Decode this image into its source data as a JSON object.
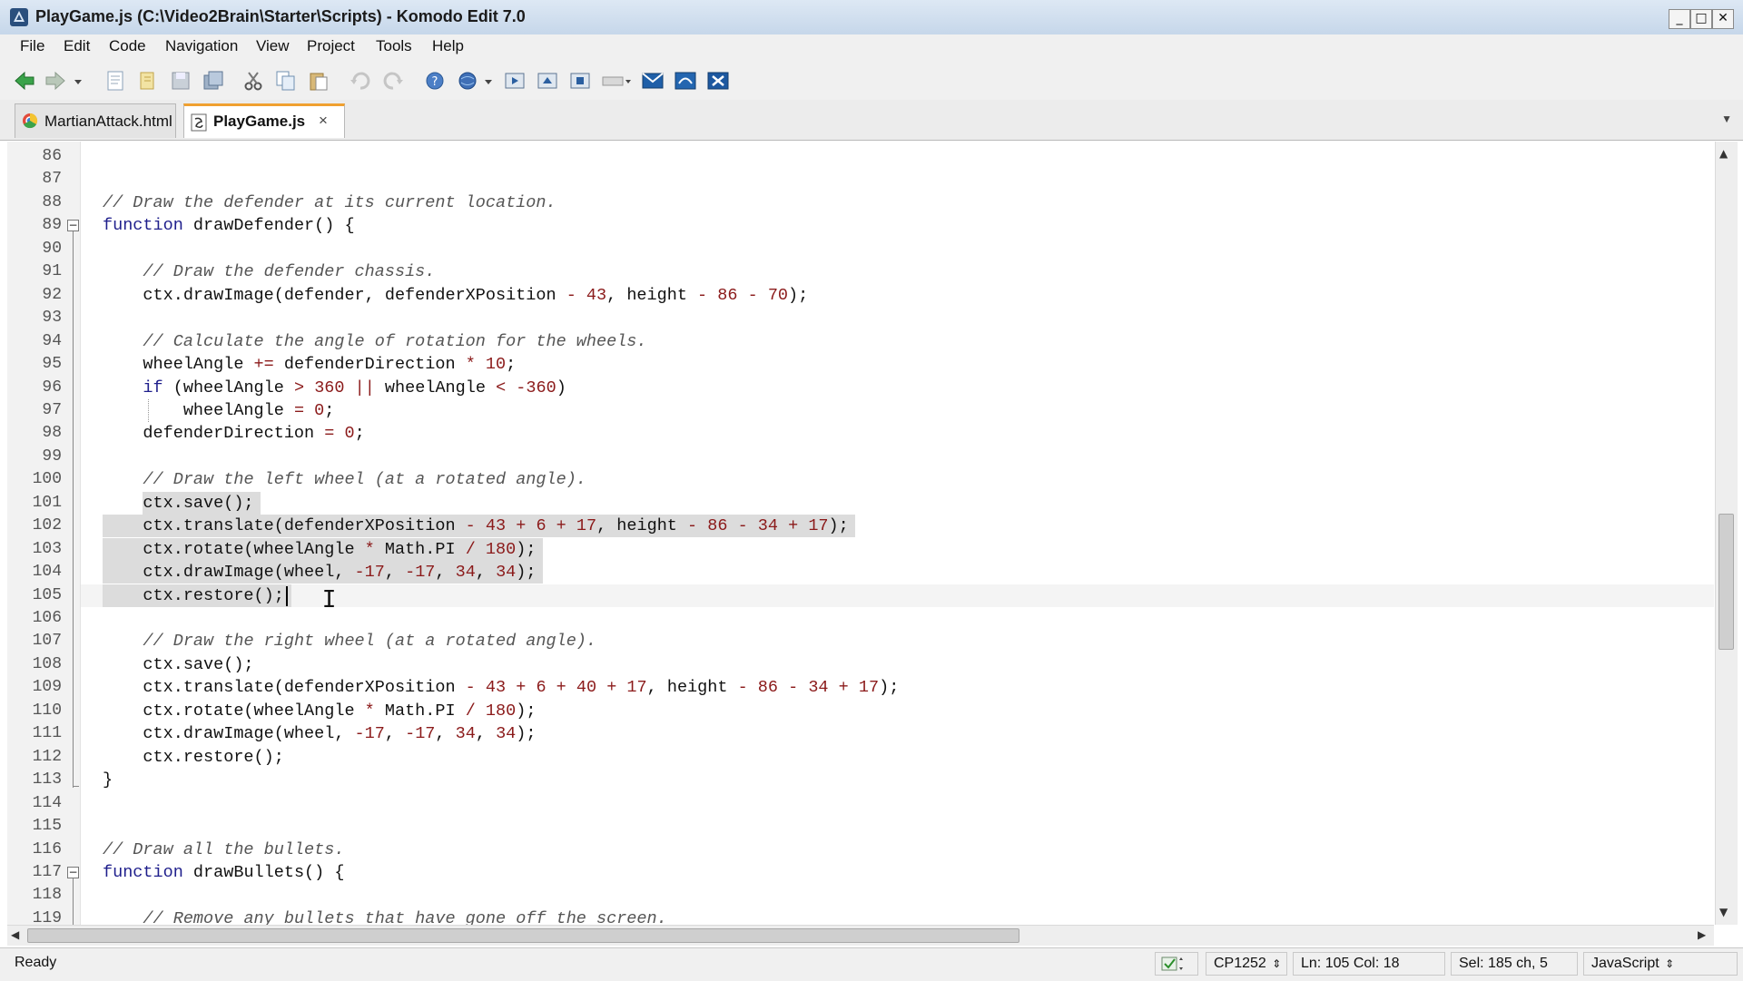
{
  "window": {
    "title": "PlayGame.js (C:\\Video2Brain\\Starter\\Scripts) - Komodo Edit 7.0",
    "minimize": "_",
    "maximize": "□",
    "close": "✕"
  },
  "menu": [
    "File",
    "Edit",
    "Code",
    "Navigation",
    "View",
    "Project",
    "Tools",
    "Help"
  ],
  "tabs": [
    {
      "label": "MartianAttack.html",
      "icon": "browser-icon",
      "active": false
    },
    {
      "label": "PlayGame.js",
      "icon": "js-file-icon",
      "active": true,
      "close": "×"
    }
  ],
  "editor": {
    "lines": [
      {
        "n": "86",
        "text": ""
      },
      {
        "n": "87",
        "text": ""
      },
      {
        "n": "88",
        "text": "// Draw the defender at its current location."
      },
      {
        "n": "89",
        "text": "function drawDefender() {"
      },
      {
        "n": "90",
        "text": ""
      },
      {
        "n": "91",
        "text": "    // Draw the defender chassis."
      },
      {
        "n": "92",
        "text": "    ctx.drawImage(defender, defenderXPosition - 43, height - 86 - 70);"
      },
      {
        "n": "93",
        "text": ""
      },
      {
        "n": "94",
        "text": "    // Calculate the angle of rotation for the wheels."
      },
      {
        "n": "95",
        "text": "    wheelAngle += defenderDirection * 10;"
      },
      {
        "n": "96",
        "text": "    if (wheelAngle > 360 || wheelAngle < -360)"
      },
      {
        "n": "97",
        "text": "        wheelAngle = 0;"
      },
      {
        "n": "98",
        "text": "    defenderDirection = 0;"
      },
      {
        "n": "99",
        "text": ""
      },
      {
        "n": "100",
        "text": "    // Draw the left wheel (at a rotated angle)."
      },
      {
        "n": "101",
        "text": "    ctx.save();"
      },
      {
        "n": "102",
        "text": "    ctx.translate(defenderXPosition - 43 + 6 + 17, height - 86 - 34 + 17);"
      },
      {
        "n": "103",
        "text": "    ctx.rotate(wheelAngle * Math.PI / 180);"
      },
      {
        "n": "104",
        "text": "    ctx.drawImage(wheel, -17, -17, 34, 34);"
      },
      {
        "n": "105",
        "text": "    ctx.restore();"
      },
      {
        "n": "106",
        "text": ""
      },
      {
        "n": "107",
        "text": "    // Draw the right wheel (at a rotated angle)."
      },
      {
        "n": "108",
        "text": "    ctx.save();"
      },
      {
        "n": "109",
        "text": "    ctx.translate(defenderXPosition - 43 + 6 + 40 + 17, height - 86 - 34 + 17);"
      },
      {
        "n": "110",
        "text": "    ctx.rotate(wheelAngle * Math.PI / 180);"
      },
      {
        "n": "111",
        "text": "    ctx.drawImage(wheel, -17, -17, 34, 34);"
      },
      {
        "n": "112",
        "text": "    ctx.restore();"
      },
      {
        "n": "113",
        "text": "}"
      },
      {
        "n": "114",
        "text": ""
      },
      {
        "n": "115",
        "text": ""
      },
      {
        "n": "116",
        "text": "// Draw all the bullets."
      },
      {
        "n": "117",
        "text": "function drawBullets() {"
      },
      {
        "n": "118",
        "text": ""
      },
      {
        "n": "119",
        "text": "    // Remove any bullets that have gone off the screen."
      }
    ],
    "selection_lines": [
      "101",
      "102",
      "103",
      "104",
      "105"
    ],
    "cursor_line": "105"
  },
  "status": {
    "ready": "Ready",
    "encoding": "CP1252",
    "position": "Ln: 105 Col: 18",
    "selection": "Sel: 185 ch, 5",
    "language": "JavaScript"
  },
  "toolbar_icons": [
    "back-icon",
    "forward-icon",
    "history-dropdown-icon",
    "new-file-icon",
    "open-folder-icon",
    "save-icon",
    "save-all-icon",
    "cut-icon",
    "copy-icon",
    "paste-icon",
    "undo-icon",
    "redo-icon",
    "help-icon",
    "browser-preview-icon",
    "run-macro-icon",
    "record-macro-icon",
    "stop-macro-icon",
    "toolbox-icon",
    "mail-icon",
    "remote-icon",
    "scc-icon"
  ]
}
